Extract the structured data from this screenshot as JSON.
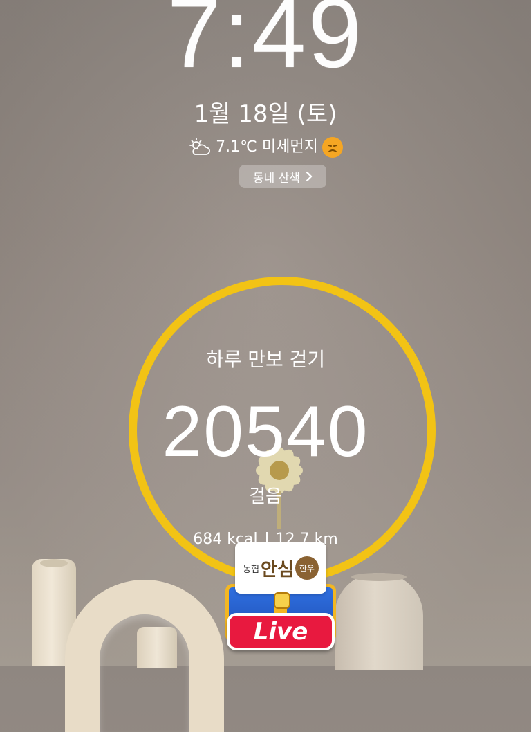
{
  "lockscreen": {
    "time": "7:49",
    "date": "1월 18일 (토)",
    "weather": {
      "icon": "partly-cloudy-sun-icon",
      "text": "7.1℃ 미세먼지",
      "dust_icon": "bad-face-icon",
      "dust_color": "#f5a623"
    },
    "chip": {
      "label": "동네 산책",
      "icon": "chevron-right-icon"
    }
  },
  "steps_widget": {
    "title": "하루 만보 걷기",
    "count": "20540",
    "unit": "걸음",
    "calories": "684 kcal",
    "distance": "12.7 km",
    "ring_color": "#f2c315"
  },
  "live_badge": {
    "brand_prefix": "농협",
    "brand_main": "안심",
    "brand_suffix": "한우",
    "label": "Live",
    "label_color": "#e8193f"
  }
}
